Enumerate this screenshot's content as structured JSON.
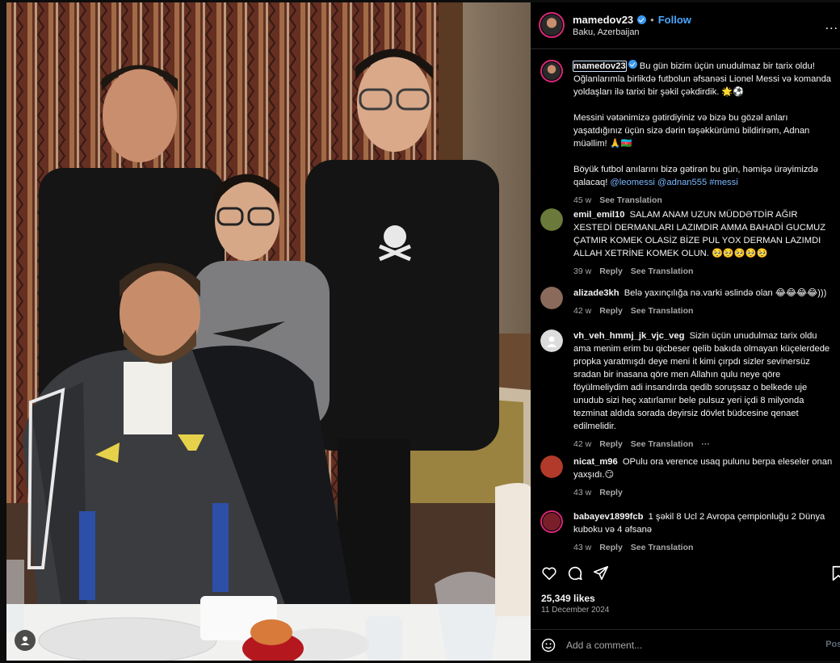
{
  "post": {
    "author": "mamedov23",
    "follow_label": "Follow",
    "location": "Baku, Azerbaijan",
    "more_label": "...",
    "caption_p1": "Bu gün bizim üçün unudulmaz bir tarix oldu! Oğlanlarımla birlikdə futbolun əfsanəsi Lionel Messi və komanda yoldaşları ilə tarixi bir şəkil çəkdirdik. 🌟⚽",
    "caption_p2": "Messini vətənimizə gətirdiyiniz və bizə bu gözəl anları yaşatdığınız üçün sizə dərin təşəkkürümü bildirirəm, Adnan müəllim! 🙏🇦🇿",
    "caption_p3": "Böyük futbol anılarını bizə gətirən bu gün, həmişə ürəyimizdə qalacaq!",
    "caption_tags": [
      "@leomessi",
      "@adnan555",
      "#messi"
    ],
    "caption_time": "45 w",
    "caption_translate": "See Translation"
  },
  "comments": [
    {
      "user": "emil_emil10",
      "text": "SALAM ANAM UZUN MÜDDƏTDİR AĞIR XESTEDİ DERMANLARI LAZIMDIR AMMA BAHADİ GUCMUZ ÇATMIR KOMEK OLASİZ BİZE PUL YOX DERMAN LAZIMDI ALLAH XETRİNE KOMEK OLUN. 🥺🥺🥺🥺🥺",
      "time": "39 w",
      "reply": "Reply",
      "translate": "See Translation",
      "avatar_color": "#6b7a3a"
    },
    {
      "user": "alizade3kh",
      "text": "Belə yaxınçılığa nə.varki əslində olan 😂😂😂😂)))",
      "time": "42 w",
      "reply": "Reply",
      "translate": "See Translation",
      "avatar_color": "#8a6a5a"
    },
    {
      "user": "vh_veh_hmmj_jk_vjc_veg",
      "text": "Sizin üçün unudulmaz tarix oldu ama menim erim bu qicbeser qelib bakıda olmayan küçelerdede propka yaratmışdı deye meni it kimi çırpdı sizler sevinersüz sradan bir inasana qöre men Allahın qulu neye qöre föyülmeliydim adi insandırda qedib soruşsaz o belkede uje unudub sizi heç xatırlamır bele pulsuz yeri içdi 8 milyonda tezminat aldıda sorada deyirsiz dövlet büdcesine qenaet edilmelidir.",
      "time": "42 w",
      "reply": "Reply",
      "translate": "See Translation",
      "more": "···",
      "avatar_color": "#dcdcdc"
    },
    {
      "user": "nicat_m96",
      "text": "OPulu ora verence usaq pulunu berpa eleseler onan yaxşıdı.😏",
      "time": "43 w",
      "reply": "Reply",
      "avatar_color": "#b23a2a"
    },
    {
      "user": "babayev1899fcb",
      "text": "1 şəkil 8 Ucl 2 Avropa çempionluğu 2 Dünya kuboku və 4 əfsanə",
      "time": "43 w",
      "reply": "Reply",
      "translate": "See Translation",
      "avatar_color": "#7a1f2a"
    }
  ],
  "likes": "25,349 likes",
  "date": "11 December 2024",
  "add_comment_placeholder": "Add a comment...",
  "post_label": "Post",
  "icons": [
    "heart-icon",
    "comment-icon",
    "share-icon",
    "bookmark-icon",
    "emoji-icon",
    "tagged-user-icon"
  ]
}
